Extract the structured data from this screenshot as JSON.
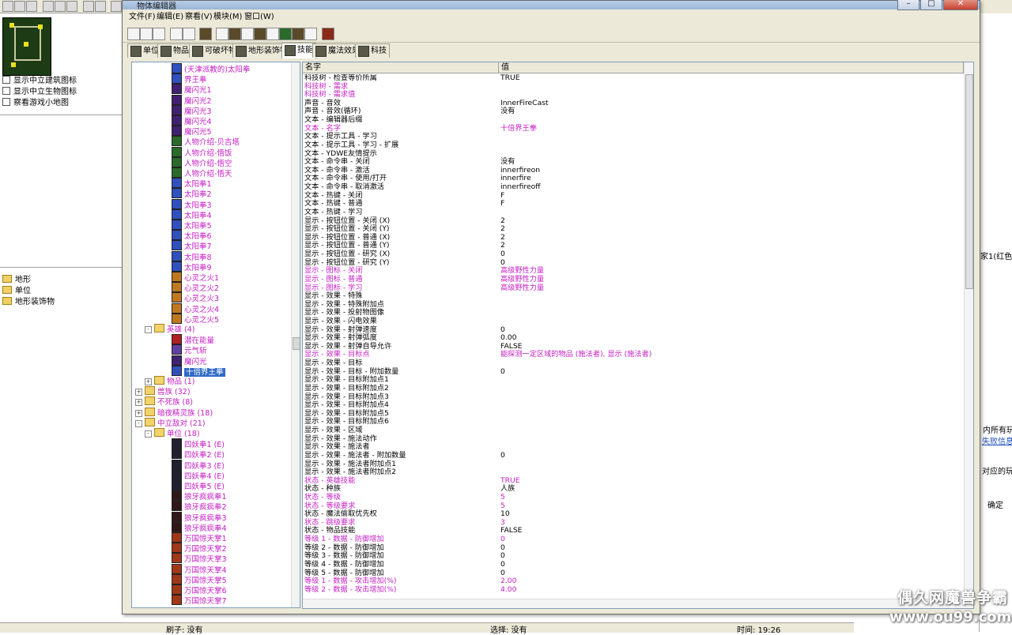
{
  "left_panel": {
    "checkboxes": [
      "显示中立建筑图标",
      "显示中立生物图标",
      "察看游戏小地图"
    ],
    "folders": [
      "地形",
      "单位",
      "地形装饰物"
    ]
  },
  "statusbar": {
    "brush": "刷子: 没有",
    "select": "选择: 没有",
    "time": "时间: 19:26"
  },
  "right_edge": {
    "lines": [
      "家1(红色)",
      "内所有玩",
      "失败信息:",
      "对应的玩家",
      "确定"
    ]
  },
  "watermark": {
    "line1": "偶久网魔兽争霸",
    "line2": "www.ou99.com"
  },
  "window": {
    "title": "物体编辑器",
    "menus": [
      "文件(F)",
      "编辑(E)",
      "察看(V)",
      "模块(M)",
      "窗口(W)"
    ],
    "tabs": [
      "单位",
      "物品",
      "可破坏物",
      "地形装饰物",
      "技能",
      "魔法效果",
      "科技"
    ],
    "active_tab": "技能"
  },
  "tree": [
    {
      "text": "(天津派教的)太阳拳",
      "color": "magenta",
      "indent": 2,
      "icon": "#3050c0"
    },
    {
      "text": "界王拳",
      "color": "magenta",
      "indent": 2,
      "icon": "#3050c0"
    },
    {
      "text": "魔闪光1",
      "color": "magenta",
      "indent": 2,
      "icon": "#402070"
    },
    {
      "text": "魔闪光2",
      "color": "magenta",
      "indent": 2,
      "icon": "#402070"
    },
    {
      "text": "魔闪光3",
      "color": "magenta",
      "indent": 2,
      "icon": "#402070"
    },
    {
      "text": "魔闪光4",
      "color": "magenta",
      "indent": 2,
      "icon": "#402070"
    },
    {
      "text": "魔闪光5",
      "color": "magenta",
      "indent": 2,
      "icon": "#402070"
    },
    {
      "text": "人物介绍-贝吉塔",
      "color": "magenta",
      "indent": 2,
      "icon": "#2a6a2a"
    },
    {
      "text": "人物介绍-悟饭",
      "color": "magenta",
      "indent": 2,
      "icon": "#2a6a2a"
    },
    {
      "text": "人物介绍-悟空",
      "color": "magenta",
      "indent": 2,
      "icon": "#2a6a2a"
    },
    {
      "text": "人物介绍-悟天",
      "color": "magenta",
      "indent": 2,
      "icon": "#2a6a2a"
    },
    {
      "text": "太阳拳1",
      "color": "magenta",
      "indent": 2,
      "icon": "#3050c0"
    },
    {
      "text": "太阳拳2",
      "color": "magenta",
      "indent": 2,
      "icon": "#3050c0"
    },
    {
      "text": "太阳拳3",
      "color": "magenta",
      "indent": 2,
      "icon": "#3050c0"
    },
    {
      "text": "太阳拳4",
      "color": "magenta",
      "indent": 2,
      "icon": "#3050c0"
    },
    {
      "text": "太阳拳5",
      "color": "magenta",
      "indent": 2,
      "icon": "#3050c0"
    },
    {
      "text": "太阳拳6",
      "color": "magenta",
      "indent": 2,
      "icon": "#3050c0"
    },
    {
      "text": "太阳拳7",
      "color": "magenta",
      "indent": 2,
      "icon": "#3050c0"
    },
    {
      "text": "太阳拳8",
      "color": "magenta",
      "indent": 2,
      "icon": "#3050c0"
    },
    {
      "text": "太阳拳9",
      "color": "magenta",
      "indent": 2,
      "icon": "#3050c0"
    },
    {
      "text": "心灵之火1",
      "color": "magenta",
      "indent": 2,
      "icon": "#c07820"
    },
    {
      "text": "心灵之火2",
      "color": "magenta",
      "indent": 2,
      "icon": "#c07820"
    },
    {
      "text": "心灵之火3",
      "color": "magenta",
      "indent": 2,
      "icon": "#c07820"
    },
    {
      "text": "心灵之火4",
      "color": "magenta",
      "indent": 2,
      "icon": "#c07820"
    },
    {
      "text": "心灵之火5",
      "color": "magenta",
      "indent": 2,
      "icon": "#c07820"
    },
    {
      "text": "英雄 (4)",
      "color": "magenta",
      "indent": 1,
      "folder": true,
      "expand": "-"
    },
    {
      "text": "潜在能量",
      "color": "magenta",
      "indent": 2,
      "icon": "#b02020"
    },
    {
      "text": "元气斩",
      "color": "magenta",
      "indent": 2,
      "icon": "#6040a0"
    },
    {
      "text": "魔闪光",
      "color": "magenta",
      "indent": 2,
      "icon": "#402070"
    },
    {
      "text": "十倍界王拳",
      "color": "magenta",
      "indent": 2,
      "icon": "#3050c0",
      "selected": true
    },
    {
      "text": "物品 (1)",
      "color": "magenta",
      "indent": 1,
      "folder": true,
      "expand": "+"
    },
    {
      "text": "兽族 (32)",
      "color": "magenta",
      "indent": 0,
      "folder": true,
      "expand": "+"
    },
    {
      "text": "不死族 (8)",
      "color": "magenta",
      "indent": 0,
      "folder": true,
      "expand": "+"
    },
    {
      "text": "暗夜精灵族 (18)",
      "color": "magenta",
      "indent": 0,
      "folder": true,
      "expand": "+"
    },
    {
      "text": "中立敌对 (21)",
      "color": "magenta",
      "indent": 0,
      "folder": true,
      "expand": "-"
    },
    {
      "text": "单位 (18)",
      "color": "magenta",
      "indent": 1,
      "folder": true,
      "expand": "-"
    },
    {
      "text": "四妖拳1 (E)",
      "color": "magenta",
      "indent": 2,
      "icon": "#202030"
    },
    {
      "text": "四妖拳2 (E)",
      "color": "magenta",
      "indent": 2,
      "icon": "#202030"
    },
    {
      "text": "四妖拳3 (E)",
      "color": "magenta",
      "indent": 2,
      "icon": "#202030"
    },
    {
      "text": "四妖拳4 (E)",
      "color": "magenta",
      "indent": 2,
      "icon": "#202030"
    },
    {
      "text": "四妖拳5 (E)",
      "color": "magenta",
      "indent": 2,
      "icon": "#202030"
    },
    {
      "text": "狼牙疯疯拳1",
      "color": "magenta",
      "indent": 2,
      "icon": "#301818"
    },
    {
      "text": "狼牙疯疯拳2",
      "color": "magenta",
      "indent": 2,
      "icon": "#301818"
    },
    {
      "text": "狼牙疯疯拳3",
      "color": "magenta",
      "indent": 2,
      "icon": "#301818"
    },
    {
      "text": "狼牙疯疯拳4",
      "color": "magenta",
      "indent": 2,
      "icon": "#301818"
    },
    {
      "text": "万国惊天掌1",
      "color": "magenta",
      "indent": 2,
      "icon": "#a03818"
    },
    {
      "text": "万国惊天掌2",
      "color": "magenta",
      "indent": 2,
      "icon": "#a03818"
    },
    {
      "text": "万国惊天掌3",
      "color": "magenta",
      "indent": 2,
      "icon": "#a03818"
    },
    {
      "text": "万国惊天掌4",
      "color": "magenta",
      "indent": 2,
      "icon": "#a03818"
    },
    {
      "text": "万国惊天掌5",
      "color": "magenta",
      "indent": 2,
      "icon": "#a03818"
    },
    {
      "text": "万国惊天掌6",
      "color": "magenta",
      "indent": 2,
      "icon": "#a03818"
    },
    {
      "text": "万国惊天掌7",
      "color": "magenta",
      "indent": 2,
      "icon": "#a03818"
    }
  ],
  "grid": {
    "header": {
      "name": "名字",
      "value": "值"
    },
    "rows": [
      {
        "n": "科技树 - 检查等价所属",
        "v": "TRUE",
        "m": false
      },
      {
        "n": "科技树 - 需求",
        "v": "",
        "m": true
      },
      {
        "n": "科技树 - 需求值",
        "v": "",
        "m": true
      },
      {
        "n": "声音 - 音效",
        "v": "InnerFireCast",
        "m": false
      },
      {
        "n": "声音 - 音效(循环)",
        "v": "没有",
        "m": false
      },
      {
        "n": "文本 - 编辑器后缀",
        "v": "",
        "m": false
      },
      {
        "n": "文本 - 名字",
        "v": "十倍界王拳",
        "m": true
      },
      {
        "n": "文本 - 提示工具 - 学习",
        "v": "",
        "m": false
      },
      {
        "n": "文本 - 提示工具 - 学习 - 扩展",
        "v": "",
        "m": false
      },
      {
        "n": "文本 - YDWE友情提示",
        "v": "",
        "m": false
      },
      {
        "n": "文本 - 命令串 - 关闭",
        "v": "没有",
        "m": false
      },
      {
        "n": "文本 - 命令串 - 激活",
        "v": "innerfireon",
        "m": false
      },
      {
        "n": "文本 - 命令串 - 使用/打开",
        "v": "innerfire",
        "m": false
      },
      {
        "n": "文本 - 命令串 - 取消激活",
        "v": "innerfireoff",
        "m": false
      },
      {
        "n": "文本 - 热键 - 关闭",
        "v": "F",
        "m": false
      },
      {
        "n": "文本 - 热键 - 普通",
        "v": "F",
        "m": false
      },
      {
        "n": "文本 - 热键 - 学习",
        "v": "",
        "m": false
      },
      {
        "n": "显示 - 按钮位置 - 关闭 (X)",
        "v": "2",
        "m": false
      },
      {
        "n": "显示 - 按钮位置 - 关闭 (Y)",
        "v": "2",
        "m": false
      },
      {
        "n": "显示 - 按钮位置 - 普通 (X)",
        "v": "2",
        "m": false
      },
      {
        "n": "显示 - 按钮位置 - 普通 (Y)",
        "v": "2",
        "m": false
      },
      {
        "n": "显示 - 按钮位置 - 研究 (X)",
        "v": "0",
        "m": false
      },
      {
        "n": "显示 - 按钮位置 - 研究 (Y)",
        "v": "0",
        "m": false
      },
      {
        "n": "显示 - 图标 - 关闭",
        "v": "高级野性力量",
        "m": true
      },
      {
        "n": "显示 - 图标 - 普通",
        "v": "高级野性力量",
        "m": true
      },
      {
        "n": "显示 - 图标 - 学习",
        "v": "高级野性力量",
        "m": true
      },
      {
        "n": "显示 - 效果 - 特殊",
        "v": "",
        "m": false
      },
      {
        "n": "显示 - 效果 - 特殊附加点",
        "v": "",
        "m": false
      },
      {
        "n": "显示 - 效果 - 投射物图像",
        "v": "",
        "m": false
      },
      {
        "n": "显示 - 效果 - 闪电效果",
        "v": "",
        "m": false
      },
      {
        "n": "显示 - 效果 - 射弹速度",
        "v": "0",
        "m": false
      },
      {
        "n": "显示 - 效果 - 射弹弧度",
        "v": "0.00",
        "m": false
      },
      {
        "n": "显示 - 效果 - 射弹自导允许",
        "v": "FALSE",
        "m": false
      },
      {
        "n": "显示 - 效果 - 目标点",
        "v": "能探测一定区域的物品 (施法者), 显示 (施法者)",
        "m": true
      },
      {
        "n": "显示 - 效果 - 目标",
        "v": "",
        "m": false
      },
      {
        "n": "显示 - 效果 - 目标 - 附加数量",
        "v": "0",
        "m": false
      },
      {
        "n": "显示 - 效果 - 目标附加点1",
        "v": "",
        "m": false
      },
      {
        "n": "显示 - 效果 - 目标附加点2",
        "v": "",
        "m": false
      },
      {
        "n": "显示 - 效果 - 目标附加点3",
        "v": "",
        "m": false
      },
      {
        "n": "显示 - 效果 - 目标附加点4",
        "v": "",
        "m": false
      },
      {
        "n": "显示 - 效果 - 目标附加点5",
        "v": "",
        "m": false
      },
      {
        "n": "显示 - 效果 - 目标附加点6",
        "v": "",
        "m": false
      },
      {
        "n": "显示 - 效果 - 区域",
        "v": "",
        "m": false
      },
      {
        "n": "显示 - 效果 - 施法动作",
        "v": "",
        "m": false
      },
      {
        "n": "显示 - 效果 - 施法者",
        "v": "",
        "m": false
      },
      {
        "n": "显示 - 效果 - 施法者 - 附加数量",
        "v": "0",
        "m": false
      },
      {
        "n": "显示 - 效果 - 施法者附加点1",
        "v": "",
        "m": false
      },
      {
        "n": "显示 - 效果 - 施法者附加点2",
        "v": "",
        "m": false
      },
      {
        "n": "状态 - 英雄技能",
        "v": "TRUE",
        "m": true
      },
      {
        "n": "状态 - 种族",
        "v": "人族",
        "m": false
      },
      {
        "n": "状态 - 等级",
        "v": "5",
        "m": true
      },
      {
        "n": "状态 - 等级要求",
        "v": "5",
        "m": true
      },
      {
        "n": "状态 - 魔法偷取优先权",
        "v": "10",
        "m": false
      },
      {
        "n": "状态 - 跳级要求",
        "v": "3",
        "m": true
      },
      {
        "n": "状态 - 物品技能",
        "v": "FALSE",
        "m": false
      },
      {
        "n": "等级 1 - 数据 - 防御增加",
        "v": "0",
        "m": true
      },
      {
        "n": "等级 2 - 数据 - 防御增加",
        "v": "0",
        "m": false
      },
      {
        "n": "等级 3 - 数据 - 防御增加",
        "v": "0",
        "m": false
      },
      {
        "n": "等级 4 - 数据 - 防御增加",
        "v": "0",
        "m": false
      },
      {
        "n": "等级 5 - 数据 - 防御增加",
        "v": "0",
        "m": false
      },
      {
        "n": "等级 1 - 数据 - 攻击增加(%)",
        "v": "2.00",
        "m": true
      },
      {
        "n": "等级 2 - 数据 - 攻击增加(%)",
        "v": "4.00",
        "m": true
      }
    ]
  },
  "colors": {
    "magenta": "#c41ec4",
    "selection": "#316ac5",
    "chrome": "#ece9d8"
  }
}
